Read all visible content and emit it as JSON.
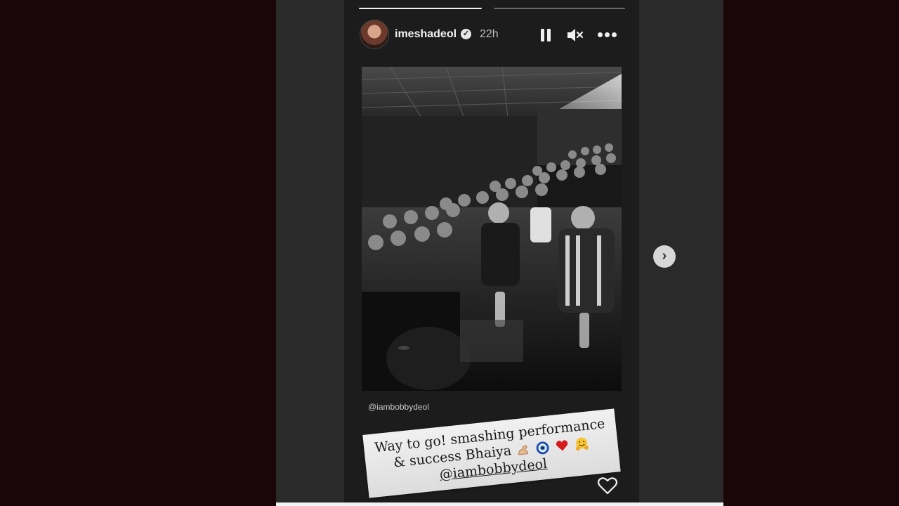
{
  "story": {
    "username": "imeshadeol",
    "verified_mark": "✓",
    "timestamp": "22h",
    "progress": [
      1.0,
      0.0
    ],
    "photo_tag": "@iambobbydeol",
    "caption": {
      "line1": "Way to go! smashing performance",
      "line2": "& success Bhaiya",
      "line3": "@iambobbydeol",
      "emojis": [
        "flexed-biceps-icon",
        "nazar-amulet-icon",
        "red-heart-icon",
        "hugging-face-icon"
      ]
    },
    "next_arrow": "›"
  },
  "colors": {
    "page_bg": "#1a0608",
    "panel_bg": "#2a2a2a",
    "story_bg": "#1c1c1c",
    "text": "#f3f3f3"
  }
}
